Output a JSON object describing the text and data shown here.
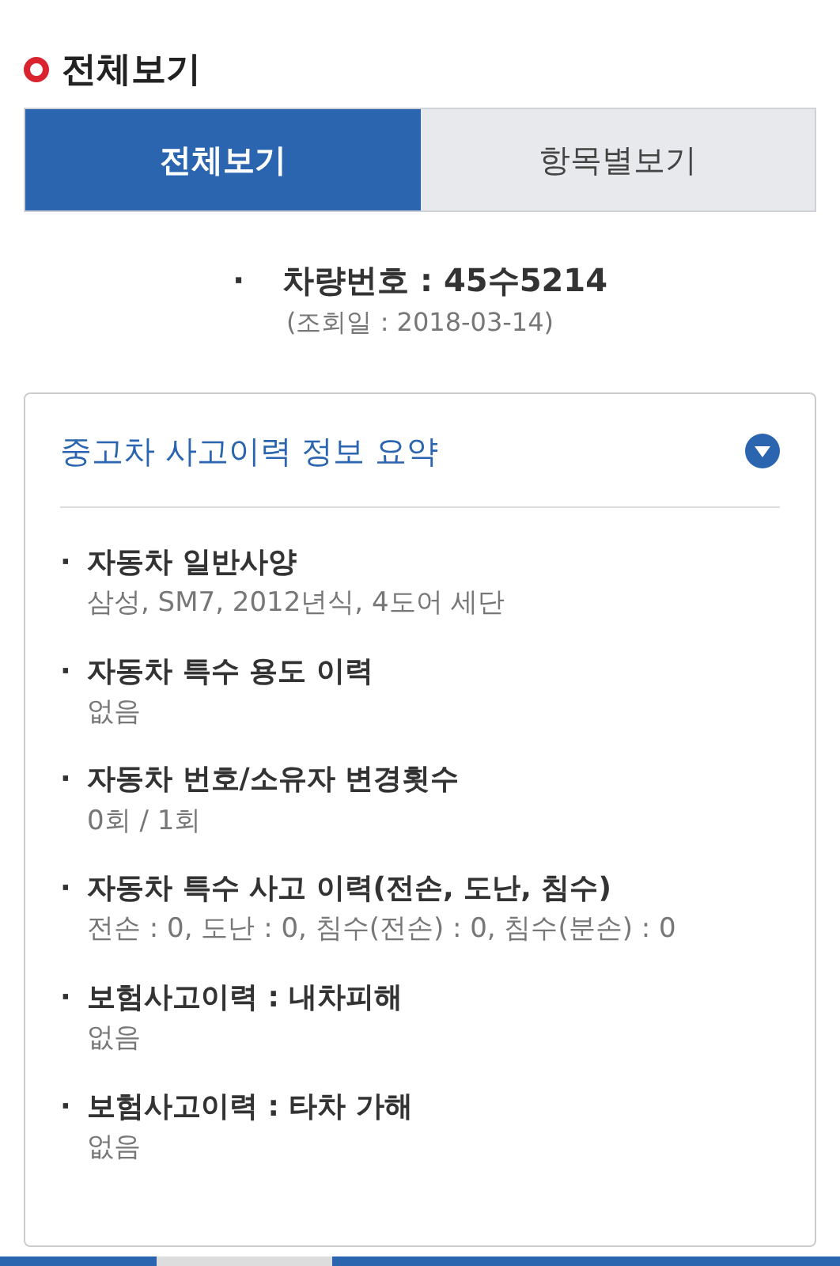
{
  "heading": "전체보기",
  "tabs": [
    {
      "label": "전체보기",
      "selected": true
    },
    {
      "label": "항목별보기",
      "selected": false
    }
  ],
  "vehicle": {
    "bullet": "·",
    "number": "차량번호 : 45수5214",
    "query_date": "(조회일 : 2018-03-14)"
  },
  "summary": {
    "title": "중고차 사고이력 정보 요약",
    "items": [
      {
        "bullet": "·",
        "label": "자동차 일반사양",
        "value": "삼성, SM7, 2012년식, 4도어 세단"
      },
      {
        "bullet": "·",
        "label": "자동차 특수 용도 이력",
        "value": "없음"
      },
      {
        "bullet": "·",
        "label": "자동차 번호/소유자 변경횟수",
        "value": "0회 / 1회"
      },
      {
        "bullet": "·",
        "label": "자동차 특수 사고 이력(전손, 도난, 침수)",
        "value": "전손 : 0, 도난 : 0, 침수(전손) : 0, 침수(분손) : 0"
      },
      {
        "bullet": "·",
        "label": "보험사고이력 : 내차피해",
        "value": "없음"
      },
      {
        "bullet": "·",
        "label": "보험사고이력 : 타차 가해",
        "value": "없음"
      }
    ]
  },
  "bottom_tabs": [
    {
      "selected": true
    },
    {
      "selected": false
    },
    {
      "selected": true
    }
  ]
}
